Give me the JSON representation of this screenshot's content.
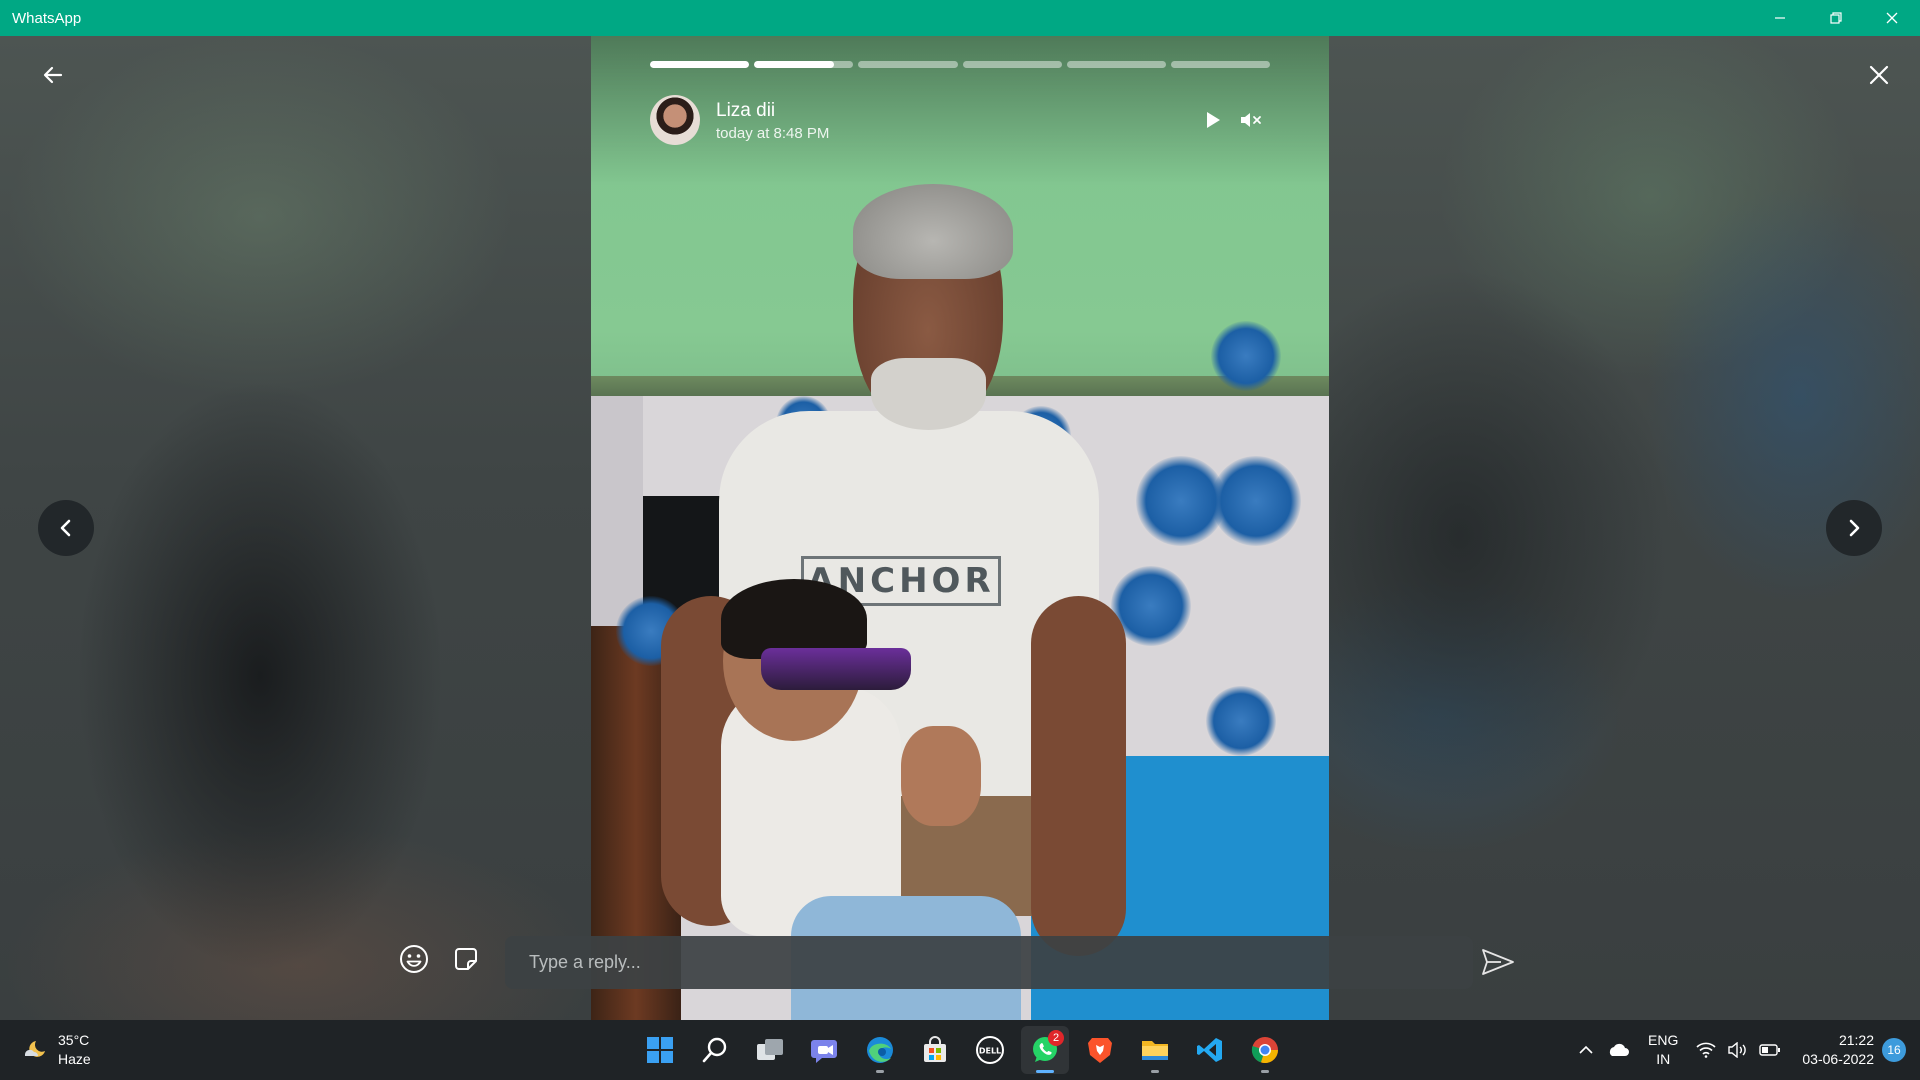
{
  "window": {
    "title": "WhatsApp"
  },
  "status": {
    "contact_name": "Liza dii",
    "timestamp": "today at 8:48 PM",
    "segments": [
      1.0,
      0.8,
      0,
      0,
      0,
      0
    ],
    "shirt_text": "ANCHOR"
  },
  "reply": {
    "placeholder": "Type a reply..."
  },
  "taskbar": {
    "weather_temp": "35°C",
    "weather_desc": "Haze",
    "apps": [
      {
        "name": "start-button",
        "icon": "windows-icon",
        "active": false
      },
      {
        "name": "search-button",
        "icon": "search-icon",
        "active": false
      },
      {
        "name": "task-view-button",
        "icon": "task-view-icon",
        "active": false
      },
      {
        "name": "teams-chat-button",
        "icon": "teams-icon",
        "active": false
      },
      {
        "name": "edge-button",
        "icon": "edge-icon",
        "active": false,
        "running": true
      },
      {
        "name": "store-button",
        "icon": "store-icon",
        "active": false
      },
      {
        "name": "dell-button",
        "icon": "dell-icon",
        "active": false
      },
      {
        "name": "whatsapp-button",
        "icon": "whatsapp-icon",
        "active": true,
        "badge": "2"
      },
      {
        "name": "brave-button",
        "icon": "brave-icon",
        "active": false
      },
      {
        "name": "file-explorer-button",
        "icon": "folder-icon",
        "active": false,
        "running": true
      },
      {
        "name": "vscode-button",
        "icon": "vscode-icon",
        "active": false
      },
      {
        "name": "chrome-button",
        "icon": "chrome-icon",
        "active": false,
        "running": true
      }
    ],
    "language_top": "ENG",
    "language_bottom": "IN",
    "time": "21:22",
    "date": "03-06-2022",
    "notification_count": "16"
  },
  "colors": {
    "titlebar": "#00a884",
    "taskbar": "#1f2326",
    "badge": "#e0262a",
    "accent": "#3d9bdc"
  }
}
